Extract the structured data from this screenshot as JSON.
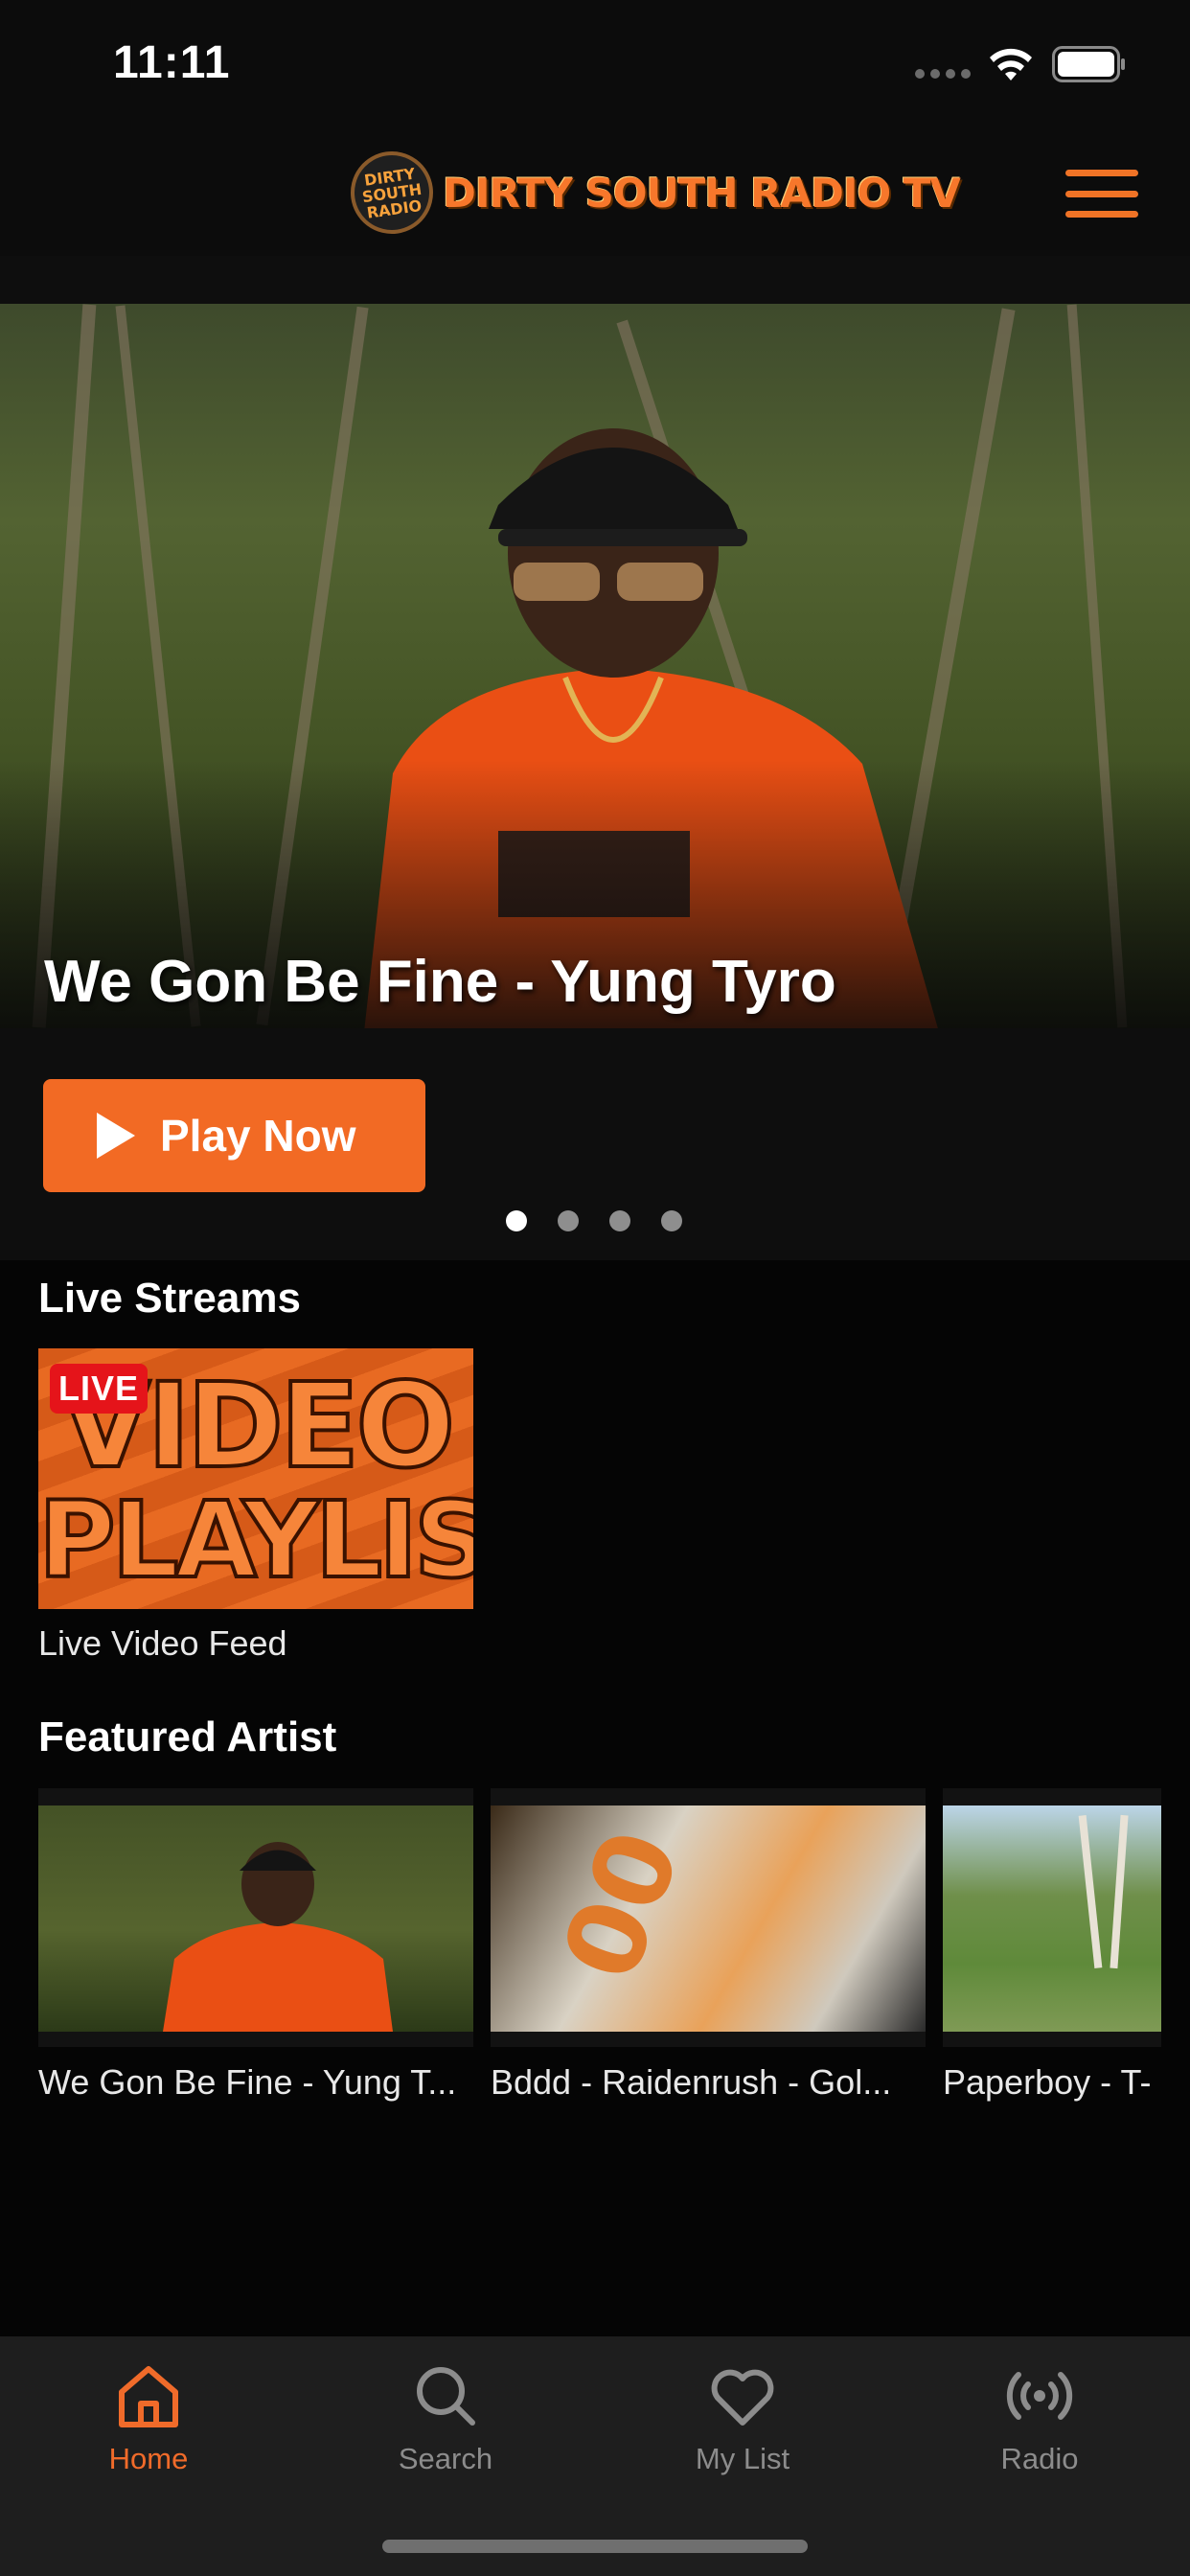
{
  "status_bar": {
    "time": "11:11"
  },
  "header": {
    "logo_badge_lines": [
      "DIRTY",
      "SOUTH",
      "RADIO"
    ],
    "logo_text": "DIRTY SOUTH RADIO TV",
    "menu_icon": "hamburger-menu-icon"
  },
  "hero": {
    "title": "We Gon Be Fine - Yung Tyro",
    "play_label": "Play Now",
    "pager_count": 4,
    "pager_active_index": 0
  },
  "live_streams": {
    "title": "Live Streams",
    "items": [
      {
        "badge": "LIVE",
        "thumbnail_text_line1": "VIDEO",
        "thumbnail_text_line2": "PLAYLIST",
        "label": "Live Video Feed"
      }
    ]
  },
  "featured_artist": {
    "title": "Featured Artist",
    "items": [
      {
        "label": "We Gon Be Fine - Yung T..."
      },
      {
        "label": "Bddd - Raidenrush - Gol..."
      },
      {
        "label": "Paperboy - T-"
      }
    ]
  },
  "tab_bar": {
    "items": [
      {
        "label": "Home",
        "icon": "home-icon",
        "active": true
      },
      {
        "label": "Search",
        "icon": "search-icon",
        "active": false
      },
      {
        "label": "My List",
        "icon": "heart-icon",
        "active": false
      },
      {
        "label": "Radio",
        "icon": "radio-broadcast-icon",
        "active": false
      }
    ]
  },
  "colors": {
    "accent": "#f26a24",
    "live_badge": "#e5141a",
    "background": "#050505",
    "tab_bar": "#1e1e1e"
  }
}
